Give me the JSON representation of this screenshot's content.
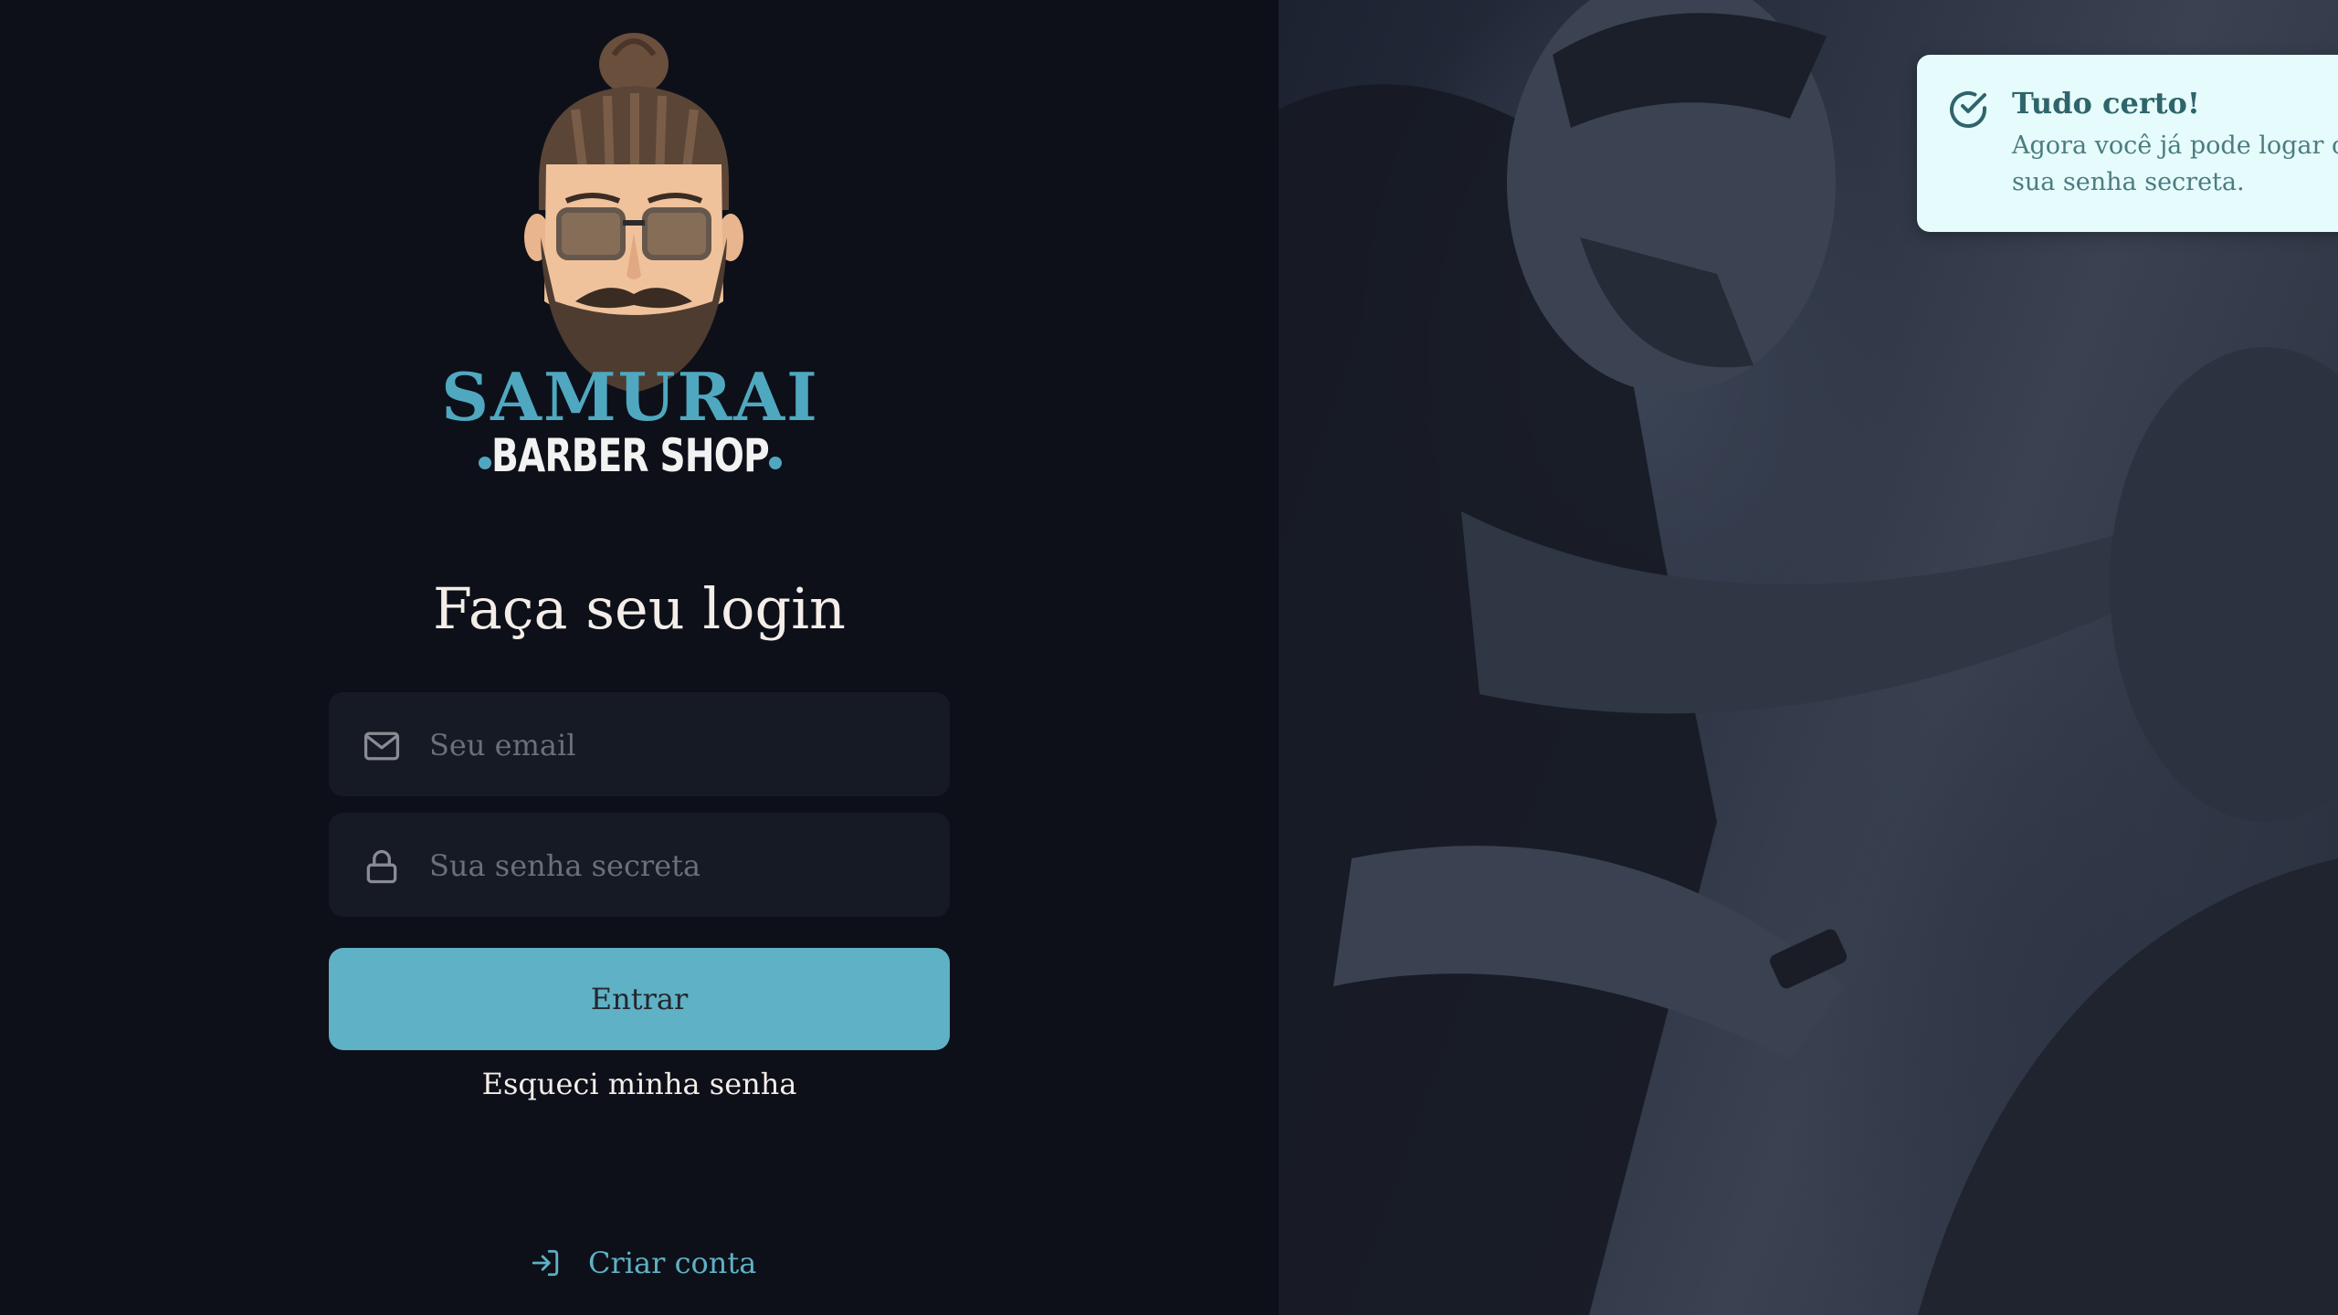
{
  "brand": {
    "name": "SAMURAI",
    "subtitle": "BARBER SHOP"
  },
  "login": {
    "heading": "Faça seu login",
    "email_placeholder": "Seu email",
    "password_placeholder": "Sua senha secreta",
    "submit_label": "Entrar",
    "forgot_label": "Esqueci minha senha"
  },
  "footer": {
    "create_account_label": "Criar conta"
  },
  "toast": {
    "title": "Tudo certo!",
    "message": "Agora você já pode logar com sua senha secreta.",
    "icon": "check-circle-icon"
  },
  "colors": {
    "background": "#0d1019",
    "accent": "#5fb1c5",
    "input_bg": "#161a24",
    "toast_bg": "#e6fbfb"
  }
}
